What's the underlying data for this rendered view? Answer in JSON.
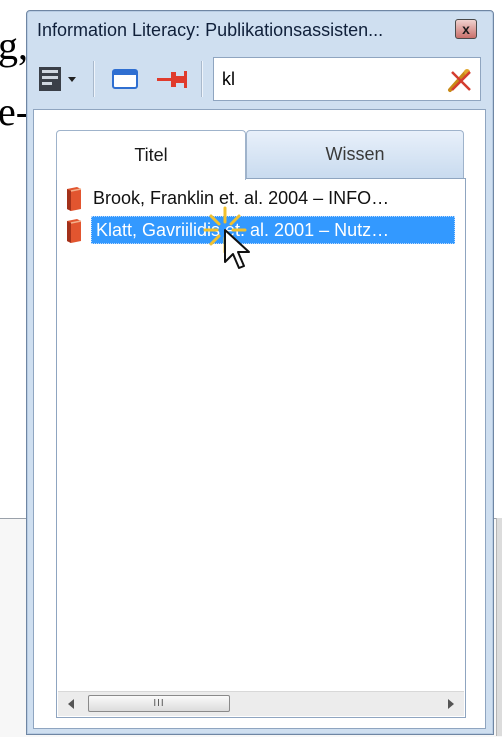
{
  "background": {
    "text_line_1": "g,",
    "text_line_2": "e-"
  },
  "window": {
    "title": "Information Literacy: Publikationsassisten...",
    "close_label": "x"
  },
  "toolbar": {
    "search": {
      "value": "kl",
      "placeholder": ""
    },
    "icons": [
      "view-menu-icon",
      "window-icon",
      "pin-icon",
      "clear-search-icon"
    ]
  },
  "tabs": [
    {
      "label": "Titel",
      "active": true
    },
    {
      "label": "Wissen",
      "active": false
    }
  ],
  "list": {
    "items": [
      {
        "text": "Brook, Franklin et. al. 2004 – INFO…",
        "selected": false
      },
      {
        "text": "Klatt, Gavriilidis et. al. 2001 – Nutz…",
        "selected": true
      }
    ]
  },
  "scrollbar": {
    "thumb_label": "III"
  },
  "colors": {
    "selection": "#3399ff",
    "window_frame": "#cfdff0",
    "book_icon": "#d9462b"
  }
}
